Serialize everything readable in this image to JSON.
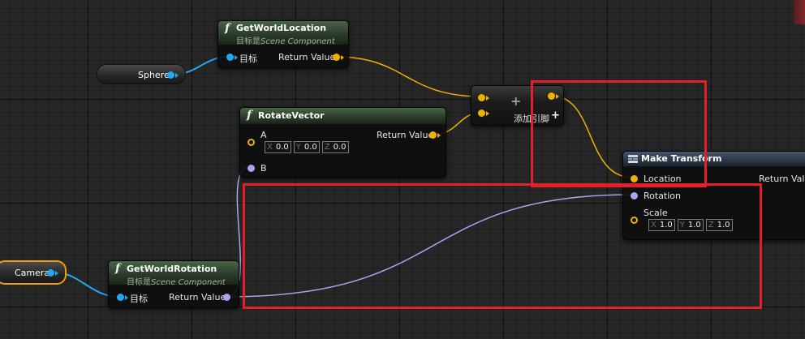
{
  "nodes": {
    "get_world_location": {
      "icon": "f",
      "title": "GetWorldLocation",
      "subtitle_prefix": "目标是",
      "subtitle_class": "Scene Component",
      "pin_target": "目标",
      "pin_return": "Return Value"
    },
    "sphere_var": {
      "label": "Sphere"
    },
    "camera_var": {
      "label": "Camera"
    },
    "rotate_vector": {
      "icon": "f",
      "title": "RotateVector",
      "pin_a": "A",
      "pin_b": "B",
      "pin_return": "Return Value",
      "a_vector": [
        {
          "axis": "X",
          "value": "0.0"
        },
        {
          "axis": "Y",
          "value": "0.0"
        },
        {
          "axis": "Z",
          "value": "0.0"
        }
      ]
    },
    "add_node": {
      "symbol": "+",
      "add_pin_label": "添加引脚",
      "add_pin_symbol": "+"
    },
    "get_world_rotation": {
      "icon": "f",
      "title": "GetWorldRotation",
      "subtitle_prefix": "目标是",
      "subtitle_class": "Scene Component",
      "pin_target": "目标",
      "pin_return": "Return Value"
    },
    "make_transform": {
      "title": "Make Transform",
      "pin_location": "Location",
      "pin_rotation": "Rotation",
      "pin_scale": "Scale",
      "pin_return": "Return Value",
      "scale_vector": [
        {
          "axis": "X",
          "value": "1.0"
        },
        {
          "axis": "Y",
          "value": "1.0"
        },
        {
          "axis": "Z",
          "value": "1.0"
        }
      ]
    }
  },
  "colors": {
    "vector_pin": "#f0b000",
    "object_pin": "#22a8f2",
    "rotator_pin": "#a3a7ee",
    "highlight": "#e3202a",
    "selected_outline": "#f0a000"
  }
}
